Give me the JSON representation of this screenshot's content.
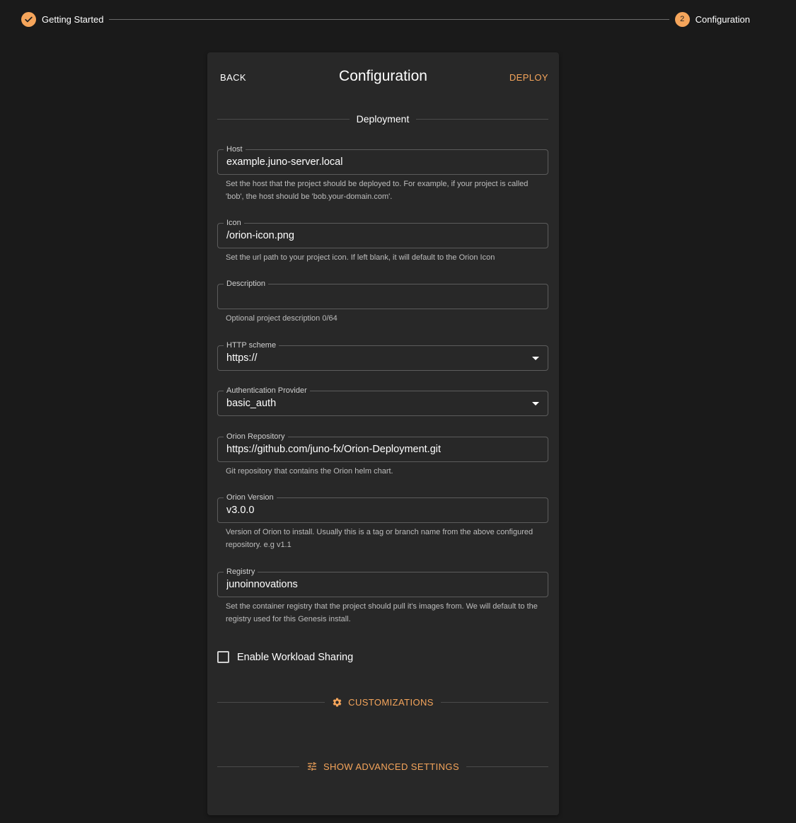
{
  "stepper": {
    "steps": [
      {
        "label": "Getting Started",
        "state": "completed"
      },
      {
        "label": "Configuration",
        "number": "2",
        "state": "active"
      }
    ]
  },
  "header": {
    "back_label": "BACK",
    "title": "Configuration",
    "deploy_label": "DEPLOY"
  },
  "section": {
    "deployment_label": "Deployment"
  },
  "fields": {
    "host": {
      "label": "Host",
      "value": "example.juno-server.local",
      "helper": "Set the host that the project should be deployed to. For example, if your project is called 'bob', the host should be 'bob.your-domain.com'."
    },
    "icon": {
      "label": "Icon",
      "value": "/orion-icon.png",
      "helper": "Set the url path to your project icon. If left blank, it will default to the Orion Icon"
    },
    "description": {
      "label": "Description",
      "value": "",
      "helper": "Optional project description 0/64"
    },
    "http_scheme": {
      "label": "HTTP scheme",
      "value": "https://"
    },
    "auth_provider": {
      "label": "Authentication Provider",
      "value": "basic_auth"
    },
    "orion_repository": {
      "label": "Orion Repository",
      "value": "https://github.com/juno-fx/Orion-Deployment.git",
      "helper": "Git repository that contains the Orion helm chart."
    },
    "orion_version": {
      "label": "Orion Version",
      "value": "v3.0.0",
      "helper": "Version of Orion to install. Usually this is a tag or branch name from the above configured repository. e.g v1.1"
    },
    "registry": {
      "label": "Registry",
      "value": "junoinnovations",
      "helper": "Set the container registry that the project should pull it's images from. We will default to the registry used for this Genesis install."
    }
  },
  "workload_sharing": {
    "label": "Enable Workload Sharing",
    "checked": false
  },
  "customizations": {
    "label": "CUSTOMIZATIONS",
    "icon": "gear-icon"
  },
  "advanced": {
    "label": "SHOW ADVANCED SETTINGS",
    "icon": "tune-icon"
  },
  "colors": {
    "accent": "#f5a55b",
    "background": "#1a1a1a",
    "card": "#282828"
  }
}
